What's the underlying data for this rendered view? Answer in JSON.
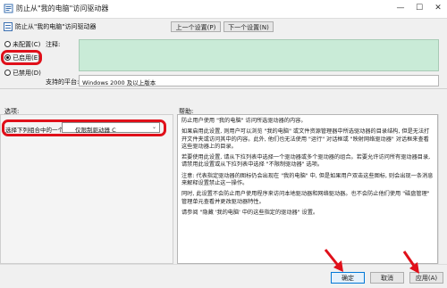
{
  "window": {
    "title": "防止从\"我的电脑\"访问驱动器",
    "minimize": "—",
    "maximize": "☐",
    "close": "✕"
  },
  "header": {
    "setting_name": "防止从\"我的电脑\"访问驱动器",
    "prev_button": "上一个设置(P)",
    "next_button": "下一个设置(N)"
  },
  "state": {
    "options": [
      {
        "label": "未配置(C)",
        "checked": false
      },
      {
        "label": "已启用(E)",
        "checked": true
      },
      {
        "label": "已禁用(D)",
        "checked": false
      }
    ]
  },
  "comment": {
    "label": "注释:",
    "value": ""
  },
  "supported": {
    "label": "支持的平台:",
    "value": "Windows 2000 及以上版本"
  },
  "options_section": {
    "label": "选项:",
    "field_label": "选择下列组合中的一个",
    "selected_value": "仅限制驱动器 C"
  },
  "help_section": {
    "label": "帮助:",
    "paragraphs": [
      "防止用户使用 \"我的电脑\" 访问所选驱动器的内容。",
      "如果启用此设置, 则用户可以浏览 \"我的电脑\" 或文件资源管理器中所选驱动器的目录结构, 但是无法打开文件夹或访问其中的内容。此外, 他们也无法使用 \"运行\" 对话框或 \"映射网络驱动器\" 对话框来查看这些驱动器上的目录。",
      "若要使用此设置, 请从下拉列表中选择一个驱动器或多个驱动器的组合。若要允许访问所有驱动器目录, 请禁用此设置或从下拉列表中选择 \"不限制驱动器\" 选项。",
      "注意: 代表指定驱动器的图标仍会出现在 \"我的电脑\" 中, 但是如果用户双击这些图标, 则会出现一条消息来解释设置禁止这一操作。",
      "同时, 此设置不会防止用户使用程序来访问本地驱动器和网络驱动器。也不会防止他们使用 \"磁盘管理\" 管理单元查看并更改驱动器特性。",
      "请参阅 \"隐藏 '我的电脑' 中的这些指定的驱动器\" 设置。"
    ]
  },
  "footer": {
    "ok_button": "确定",
    "cancel_button": "取消",
    "apply_button": "应用(A)"
  },
  "colors": {
    "annotation_red": "#e0101a",
    "comment_bg": "#c9ebd7",
    "dialog_bg": "#f0f0f0"
  }
}
